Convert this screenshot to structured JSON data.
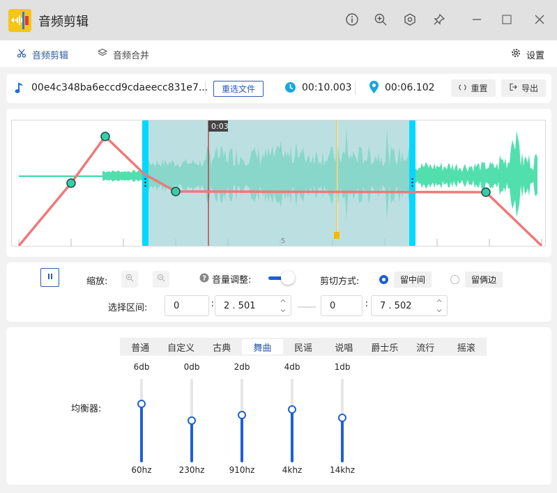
{
  "app": {
    "title": "音频剪辑"
  },
  "nav": {
    "tabs": [
      {
        "label": "音频剪辑"
      },
      {
        "label": "音频合并"
      }
    ],
    "settings_label": "设置"
  },
  "file": {
    "name": "00e4c348ba6eccd9cdaeecc831e7...",
    "reselect_label": "重选文件",
    "duration": "00:10.003",
    "position": "00:06.102",
    "reset_label": "重置",
    "export_label": "导出"
  },
  "waveform": {
    "playhead_label": "0:03",
    "tick_label": "5"
  },
  "controls": {
    "zoom_label": "缩放:",
    "volume_label": "音量调整:",
    "cut_mode_label": "剪切方式:",
    "cut_options": [
      {
        "label": "留中间",
        "selected": true
      },
      {
        "label": "留俩边",
        "selected": false
      }
    ],
    "range_label": "选择区间:",
    "start_min": "0",
    "start_sec": "2 . 501",
    "end_min": "0",
    "end_sec": "7 . 502"
  },
  "equalizer": {
    "label": "均衡器:",
    "presets": [
      {
        "label": "普通"
      },
      {
        "label": "自定义"
      },
      {
        "label": "古典"
      },
      {
        "label": "舞曲"
      },
      {
        "label": "民谣"
      },
      {
        "label": "说唱"
      },
      {
        "label": "爵士乐"
      },
      {
        "label": "流行"
      },
      {
        "label": "摇滚"
      }
    ],
    "active_preset": 3,
    "bands": [
      {
        "freq": "60hz",
        "gain": "6db",
        "level": 0.7
      },
      {
        "freq": "230hz",
        "gain": "0db",
        "level": 0.5
      },
      {
        "freq": "910hz",
        "gain": "2db",
        "level": 0.57
      },
      {
        "freq": "4khz",
        "gain": "4db",
        "level": 0.63
      },
      {
        "freq": "14khz",
        "gain": "1db",
        "level": 0.53
      }
    ]
  },
  "colors": {
    "accent": "#2d5ba8",
    "selection": "#00d8ff",
    "envelope": "#f07878",
    "wave": "#33d9a0"
  }
}
